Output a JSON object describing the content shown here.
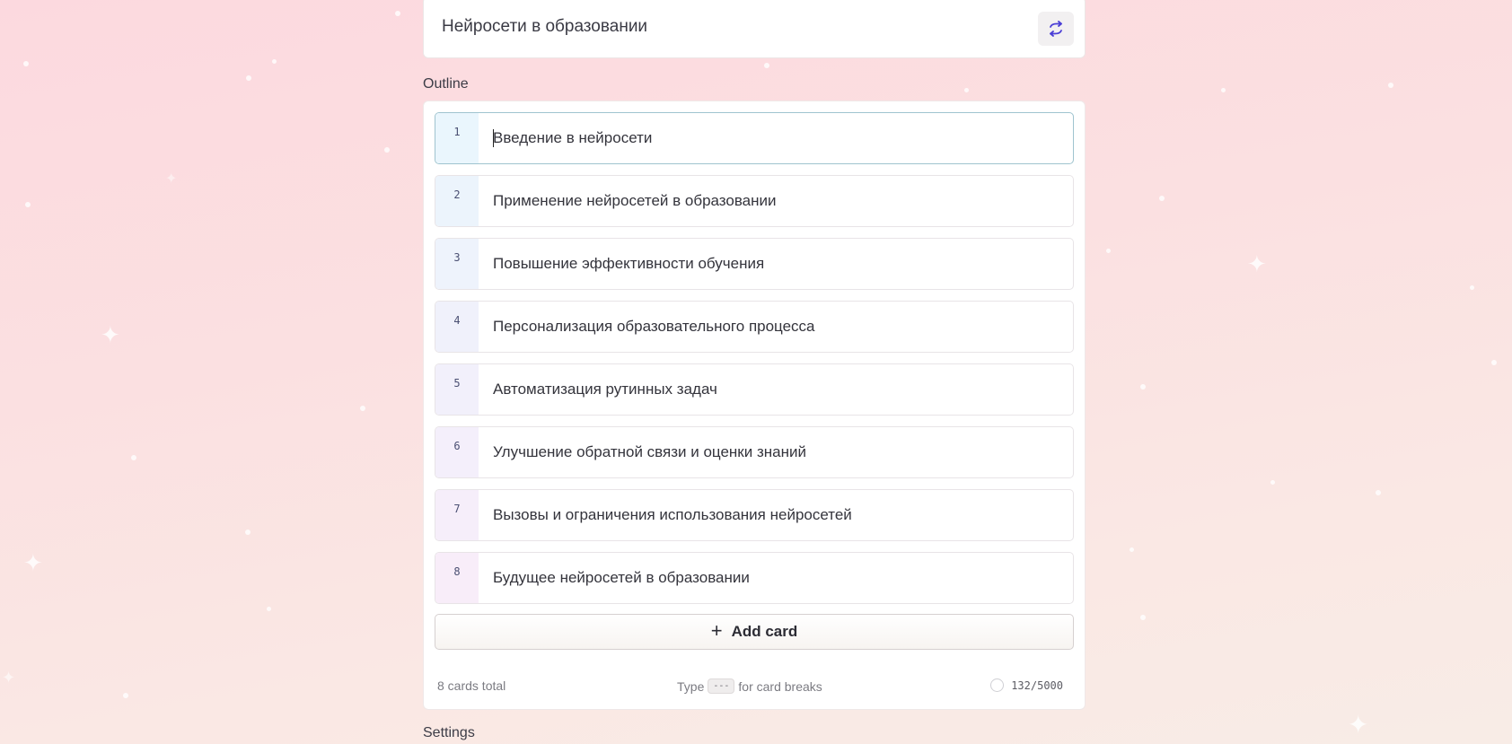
{
  "prompt": {
    "title": "Нейросети в образовании"
  },
  "outline": {
    "section_label": "Outline",
    "cards": [
      {
        "number": "1",
        "text": "Введение в нейросети",
        "accent": "#eaf6fd"
      },
      {
        "number": "2",
        "text": "Применение нейросетей в образовании",
        "accent": "#ecf4fc"
      },
      {
        "number": "3",
        "text": "Повышение эффективности обучения",
        "accent": "#eef3fc"
      },
      {
        "number": "4",
        "text": "Персонализация образовательного процесса",
        "accent": "#f0f1fb"
      },
      {
        "number": "5",
        "text": "Автоматизация рутинных задач",
        "accent": "#f2f0fb"
      },
      {
        "number": "6",
        "text": "Улучшение обратной связи и оценки знаний",
        "accent": "#f4effb"
      },
      {
        "number": "7",
        "text": "Вызовы и ограничения использования нейросетей",
        "accent": "#f6eefa"
      },
      {
        "number": "8",
        "text": "Будущее нейросетей в образовании",
        "accent": "#f8edf9"
      }
    ],
    "add_card_label": "Add card",
    "add_card_icon": "plus-icon"
  },
  "footer": {
    "total": "8 cards total",
    "hint_prefix": "Type",
    "hint_key": "---",
    "hint_suffix": "for card breaks",
    "char_count": "132/5000"
  },
  "settings": {
    "section_label": "Settings"
  },
  "colors": {
    "shuffle_icon": "#4b3fd6",
    "active_border": "#9fc4cf"
  }
}
